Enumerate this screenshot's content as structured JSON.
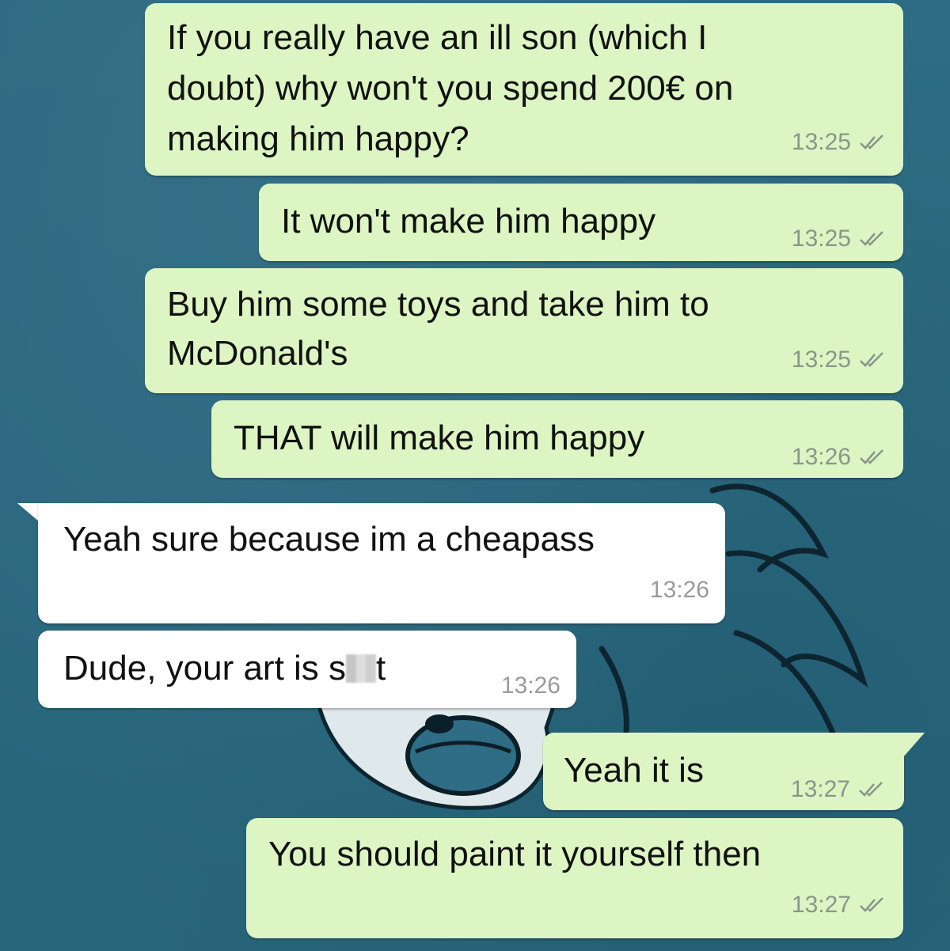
{
  "messages": [
    {
      "direction": "out",
      "lines": [
        "If you really have an ill son (which I",
        "doubt) why won't you spend 200€ on",
        "making him happy?"
      ],
      "time": "13:25"
    },
    {
      "direction": "out",
      "text": "It won't make him happy",
      "time": "13:25"
    },
    {
      "direction": "out",
      "lines": [
        "Buy him some toys and take him to",
        "McDonald's"
      ],
      "time": "13:25"
    },
    {
      "direction": "out",
      "text": "THAT will make him happy",
      "time": "13:26"
    },
    {
      "direction": "in",
      "text": "Yeah sure because im a cheapass",
      "time": "13:26"
    },
    {
      "direction": "in",
      "text_before": "Dude, your art is s",
      "text_after": "t",
      "time": "13:26"
    },
    {
      "direction": "out",
      "text": "Yeah it is",
      "time": "13:27"
    },
    {
      "direction": "out",
      "text": "You should paint it yourself then",
      "time": "13:27"
    }
  ],
  "icons": {
    "read_receipt": "double-check-icon"
  },
  "colors": {
    "outgoing_bubble": "#dcf5c3",
    "incoming_bubble": "#ffffff",
    "background": "#2b6a80",
    "timestamp": "#8a958a"
  }
}
